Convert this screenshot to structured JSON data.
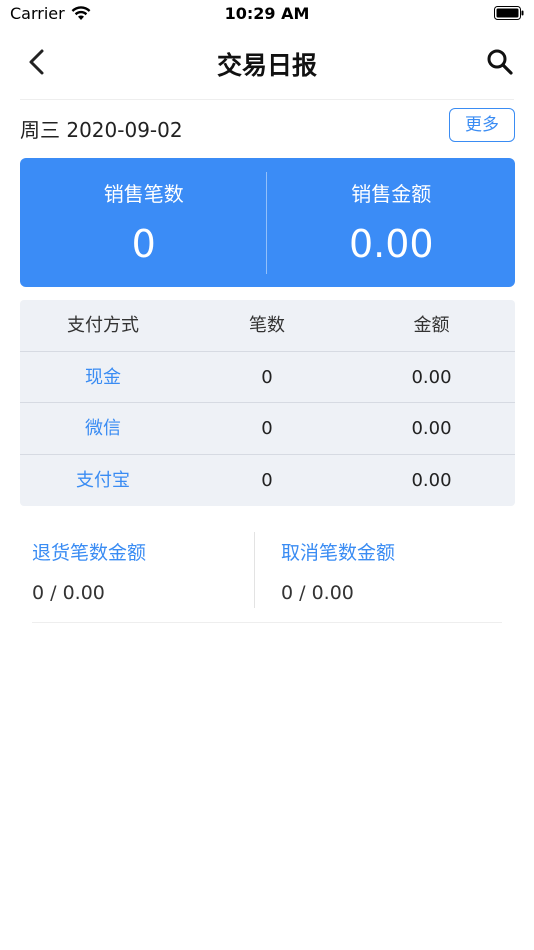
{
  "status_bar": {
    "carrier": "Carrier",
    "time": "10:29 AM"
  },
  "nav": {
    "title": "交易日报",
    "back_icon": "chevron-left-icon",
    "search_icon": "search-icon"
  },
  "date_row": {
    "date": "周三 2020-09-02",
    "more_label": "更多"
  },
  "summary": {
    "count_label": "销售笔数",
    "count_value": "0",
    "amount_label": "销售金额",
    "amount_value": "0.00",
    "color": "#3b8cf6"
  },
  "payment_table": {
    "headers": [
      "支付方式",
      "笔数",
      "金额"
    ],
    "rows": [
      {
        "method": "现金",
        "count": "0",
        "amount": "0.00"
      },
      {
        "method": "微信",
        "count": "0",
        "amount": "0.00"
      },
      {
        "method": "支付宝",
        "count": "0",
        "amount": "0.00"
      }
    ]
  },
  "refund": {
    "label": "退货笔数金额",
    "value": "0  /  0.00"
  },
  "cancel": {
    "label": "取消笔数金额",
    "value": "0  /  0.00"
  },
  "colors": {
    "accent": "#3a8cf3",
    "table_bg": "#eef1f6"
  }
}
